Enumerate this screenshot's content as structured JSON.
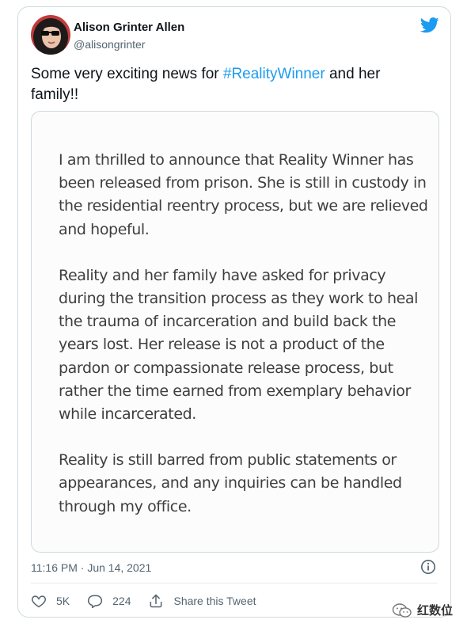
{
  "author": {
    "name": "Alison Grinter Allen",
    "handle": "@alisongrinter"
  },
  "tweet": {
    "text_before": "Some very exciting news for ",
    "hashtag": "#RealityWinner",
    "text_after": " and her family!!"
  },
  "media": {
    "paragraphs": [
      "I am thrilled to announce that Reality Winner has been released from prison. She is still in custody in the residential reentry process, but we are relieved and hopeful.",
      "Reality and her family have asked for privacy during the transition process as they work to heal the trauma of incarceration and build back the years lost. Her release is not a product of the pardon or compassionate release process, but rather the time earned from exemplary behavior while incarcerated.",
      "Reality is still barred from public statements or appearances, and any inquiries can be handled through my office."
    ]
  },
  "timestamp": "11:16 PM · Jun 14, 2021",
  "actions": {
    "likes": "5K",
    "replies": "224",
    "share_label": "Share this Tweet"
  },
  "watermark": "红数位",
  "icons": {
    "brand": "twitter-bird-icon",
    "info": "info-icon",
    "like": "heart-icon",
    "reply": "reply-icon",
    "share": "share-icon",
    "watermark": "wechat-icon"
  },
  "colors": {
    "accent": "#1d9bf0",
    "secondary_text": "#536471",
    "border": "#cfd9de"
  }
}
